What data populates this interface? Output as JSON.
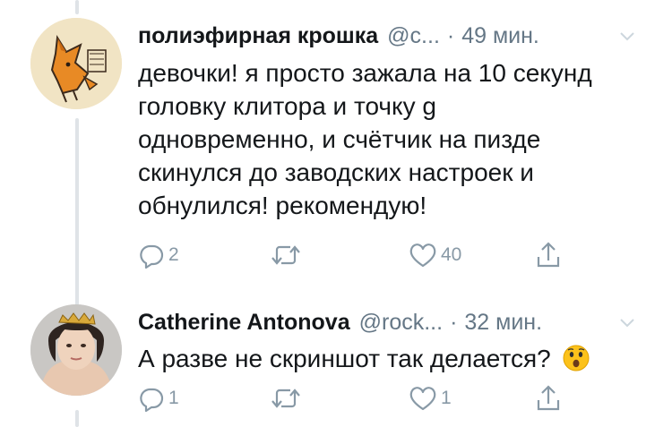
{
  "tweets": [
    {
      "name": "полиэфирная крошка",
      "handle": "@c...",
      "separator": "·",
      "time": "49 мин.",
      "lines": [
        "девочки! я просто зажала на 10 секунд",
        "головку клитора и точку g",
        "одновременно, и счётчик на пизде",
        "скинулся до заводских настроек и",
        "обнулился! рекомендую!"
      ],
      "replies": "2",
      "retweets": "",
      "likes": "40",
      "avatar": "fox-illustration"
    },
    {
      "name": "Catherine Antonova",
      "handle": "@rock...",
      "separator": "·",
      "time": "32 мин.",
      "lines": [
        "А разве не скриншот так делается?"
      ],
      "emoji": "astonished-face",
      "replies": "1",
      "retweets": "",
      "likes": "1",
      "avatar": "woman-with-crown-photo"
    }
  ],
  "colors": {
    "text": "#14171a",
    "secondary": "#657786",
    "icon": "#8899a6",
    "thread_line": "#dfe3e7"
  }
}
